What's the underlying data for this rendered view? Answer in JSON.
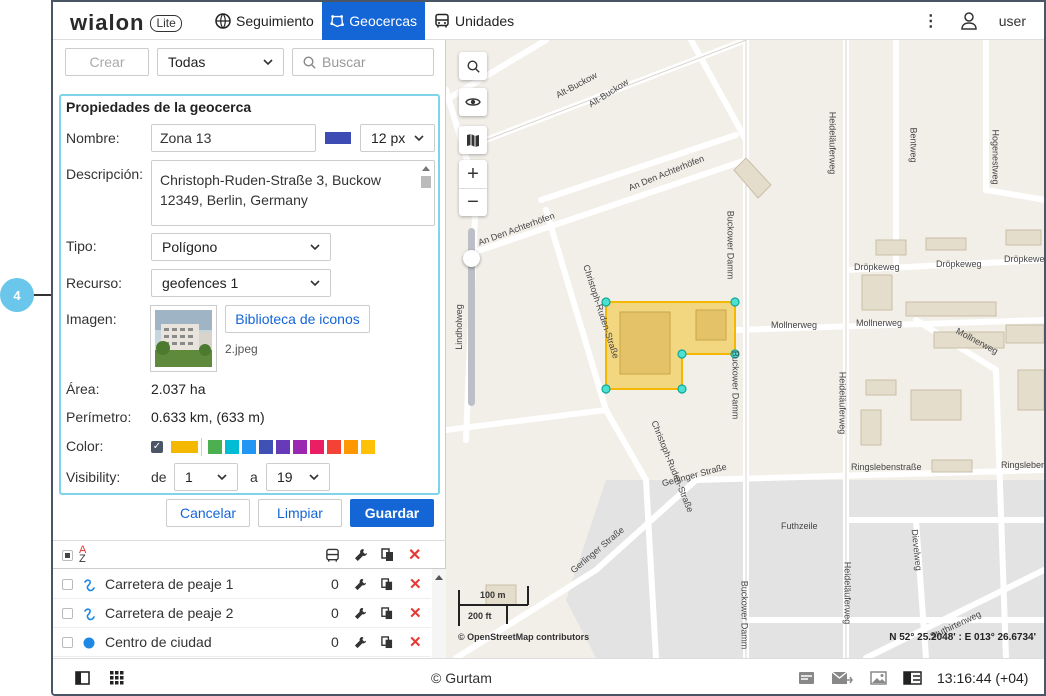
{
  "callout": {
    "number": "4"
  },
  "header": {
    "logo_text": "wialon",
    "logo_badge": "Lite",
    "tabs": [
      {
        "label": "Seguimiento",
        "icon": "globe-icon"
      },
      {
        "label": "Geocercas",
        "icon": "geofence-icon",
        "active": true
      },
      {
        "label": "Unidades",
        "icon": "bus-icon"
      }
    ],
    "user_label": "user"
  },
  "toolbar": {
    "create_label": "Crear",
    "filter_value": "Todas",
    "search_placeholder": "Buscar"
  },
  "properties": {
    "title": "Propiedades de la geocerca",
    "name_label": "Nombre:",
    "name_value": "Zona 13",
    "line_color": "#3d4bb5",
    "line_width": "12 px",
    "description_label": "Descripción:",
    "description_value": "Christoph-Ruden-Straße 3, Buckow 12349, Berlin, Germany",
    "type_label": "Tipo:",
    "type_value": "Polígono",
    "resource_label": "Recurso:",
    "resource_value": "geofences 1",
    "image_label": "Imagen:",
    "icon_library_label": "Biblioteca de iconos",
    "image_filename": "2.jpeg",
    "area_label": "Área:",
    "area_value": "2.037 ha",
    "perimeter_label": "Perímetro:",
    "perimeter_value": "0.633 km, (633 m)",
    "color_label": "Color:",
    "selected_color": "#f5b800",
    "palette": [
      "#4caf50",
      "#00bcd4",
      "#2196f3",
      "#3f51b5",
      "#673ab7",
      "#9c27b0",
      "#e91e63",
      "#f44336",
      "#ff9800",
      "#ffc107"
    ],
    "visibility_label": "Visibility:",
    "from_label": "de",
    "from_value": "1",
    "to_label": "a",
    "to_value": "19"
  },
  "actions": {
    "cancel_label": "Cancelar",
    "clear_label": "Limpiar",
    "save_label": "Guardar"
  },
  "list": {
    "rows": [
      {
        "name": "Carretera de peaje 1",
        "count": "0",
        "icon": "line-icon"
      },
      {
        "name": "Carretera de peaje 2",
        "count": "0",
        "icon": "line-icon"
      },
      {
        "name": "Centro de ciudad",
        "count": "0",
        "icon": "circle-icon"
      }
    ]
  },
  "map": {
    "streets": [
      "Alt-Buckow",
      "Alt-Buckow",
      "An Den Achterhöfen",
      "An Den Achterhöfen",
      "Lindholweg",
      "Christoph-Ruden-Straße",
      "Christoph-Ruden-Straße",
      "Buckower Damm",
      "Buckower Damm",
      "Buckower Damm",
      "Heideläuferweg",
      "Heideläuferweg",
      "Heideläuferweg",
      "Bentweg",
      "Hogenestweg",
      "Dröpkeweg",
      "Dröpkeweg",
      "Dröpkeweg",
      "Mollnerweg",
      "Mollnerweg",
      "Mollnerweg",
      "Ringslebenstraße",
      "Ringslebenstraße",
      "Gerlinger Straße",
      "Gerlinger Straße",
      "Futhzeile",
      "Dievelweg",
      "Stuthirtenweg"
    ],
    "scale_m": "100 m",
    "scale_ft": "200 ft",
    "attribution": "© OpenStreetMap contributors",
    "coordinates": "N 52° 25.2048' : E 013° 26.6734'"
  },
  "footer": {
    "copyright": "© Gurtam",
    "time": "13:16:44 (+04)"
  }
}
